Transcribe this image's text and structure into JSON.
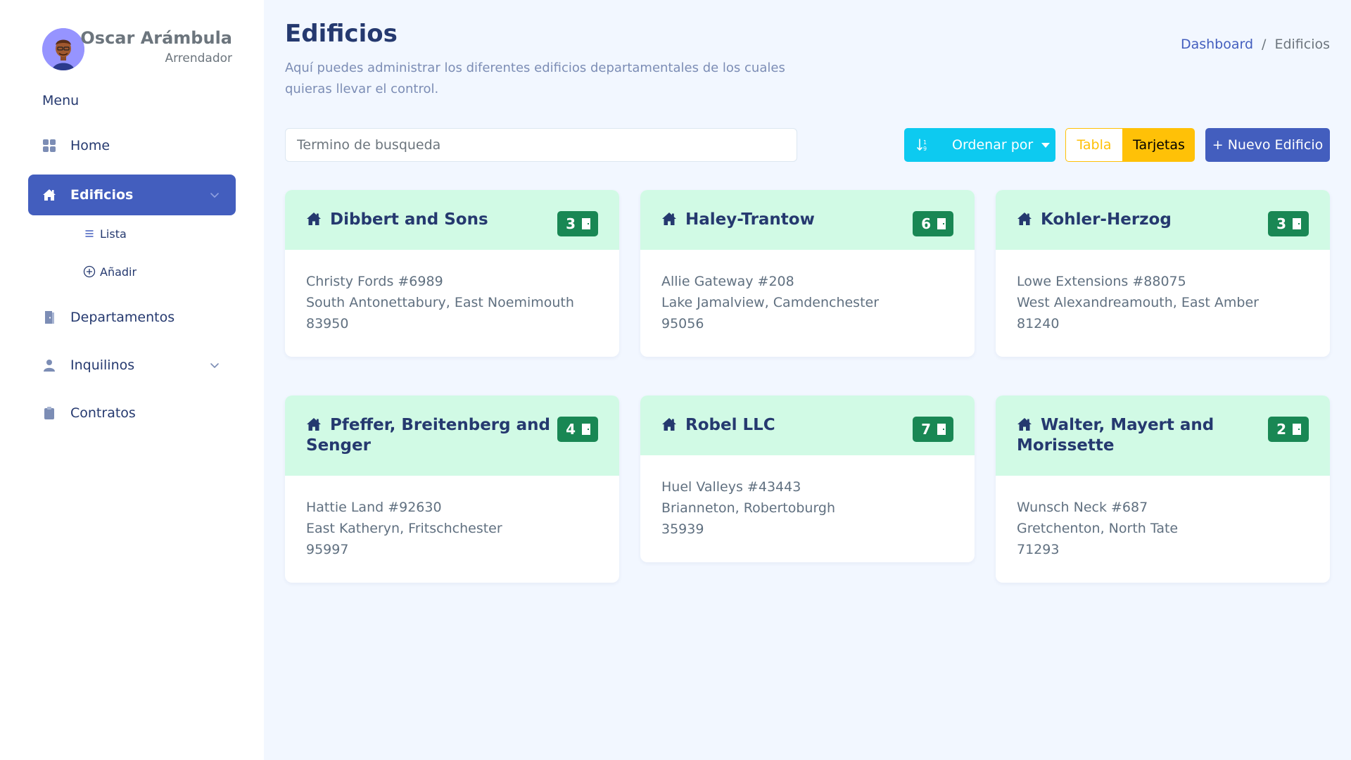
{
  "user": {
    "name": "Oscar Arámbula",
    "role": "Arrendador"
  },
  "sidebar": {
    "menu_title": "Menu",
    "items": [
      {
        "label": "Home",
        "icon": "grid-icon"
      },
      {
        "label": "Edificios",
        "icon": "house-icon",
        "active": true
      },
      {
        "label": "Departamentos",
        "icon": "door-icon"
      },
      {
        "label": "Inquilinos",
        "icon": "person-icon"
      },
      {
        "label": "Contratos",
        "icon": "clipboard-icon"
      }
    ],
    "subitems": [
      {
        "label": "Lista",
        "icon": "list-icon"
      },
      {
        "label": "Añadir",
        "icon": "plus-circle-icon"
      }
    ]
  },
  "page": {
    "title": "Edificios",
    "description": "Aquí puedes administrar los diferentes edificios departamentales de los cuales quieras llevar el control."
  },
  "breadcrumb": {
    "link": "Dashboard",
    "separator": "/",
    "current": "Edificios"
  },
  "toolbar": {
    "search_placeholder": "Termino de busqueda",
    "sort_label": "Ordenar por",
    "view_table": "Tabla",
    "view_cards": "Tarjetas",
    "new_button": "+ Nuevo Edificio"
  },
  "colors": {
    "primary": "#435ebe",
    "info": "#0dcaf0",
    "warning": "#ffc107",
    "success": "#198754",
    "card_header": "#d1fae5",
    "background": "#f2f7ff",
    "text": "#25396f"
  },
  "buildings": [
    {
      "name": "Dibbert and Sons",
      "count": "3",
      "address": "Christy Fords #6989",
      "city": "South Antonettabury, East Noemimouth",
      "zip": "83950"
    },
    {
      "name": "Haley-Trantow",
      "count": "6",
      "address": "Allie Gateway #208",
      "city": "Lake Jamalview, Camdenchester",
      "zip": "95056"
    },
    {
      "name": "Kohler-Herzog",
      "count": "3",
      "address": "Lowe Extensions #88075",
      "city": "West Alexandreamouth, East Amber",
      "zip": "81240"
    },
    {
      "name": "Pfeffer, Breitenberg and Senger",
      "count": "4",
      "address": "Hattie Land #92630",
      "city": "East Katheryn, Fritschchester",
      "zip": "95997"
    },
    {
      "name": "Robel LLC",
      "count": "7",
      "address": "Huel Valleys #43443",
      "city": "Brianneton, Robertoburgh",
      "zip": "35939"
    },
    {
      "name": "Walter, Mayert and Morissette",
      "count": "2",
      "address": "Wunsch Neck #687",
      "city": "Gretchenton, North Tate",
      "zip": "71293"
    }
  ]
}
